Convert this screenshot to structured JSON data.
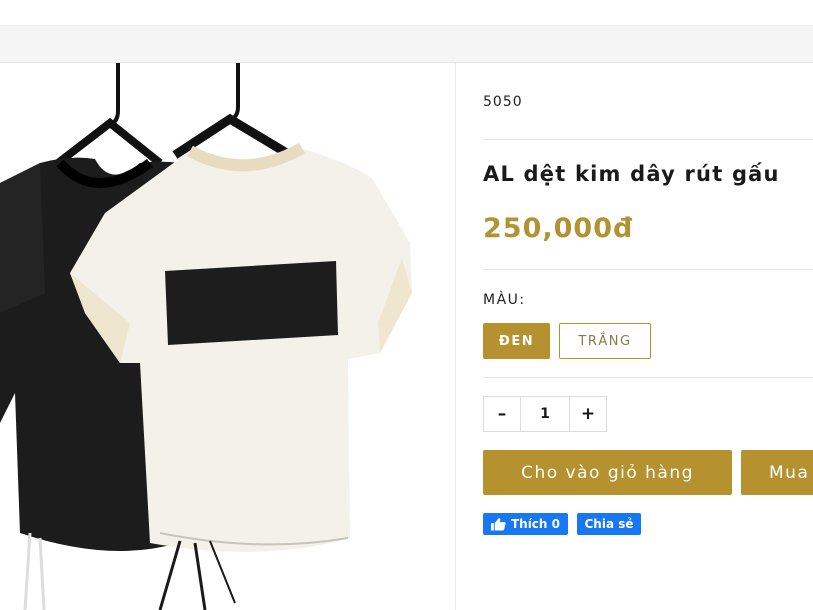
{
  "breadcrumb": {
    "prefix": "",
    "rest": ""
  },
  "product": {
    "sku": "5050",
    "title": "AL dệt kim dây rút gấu",
    "price": "250,000đ"
  },
  "options": {
    "color_label": "MÀU:",
    "colors": [
      {
        "label": "ĐEN",
        "selected": true
      },
      {
        "label": "TRẮNG",
        "selected": false
      }
    ]
  },
  "quantity": {
    "minus": "–",
    "value": "1",
    "plus": "+"
  },
  "actions": {
    "add_to_cart": "Cho vào giỏ hàng",
    "buy_now": "Mua"
  },
  "social": {
    "like": "Thích 0",
    "share": "Chia sẻ"
  },
  "colors": {
    "accent": "#b5922f",
    "facebook": "#1877f2"
  }
}
